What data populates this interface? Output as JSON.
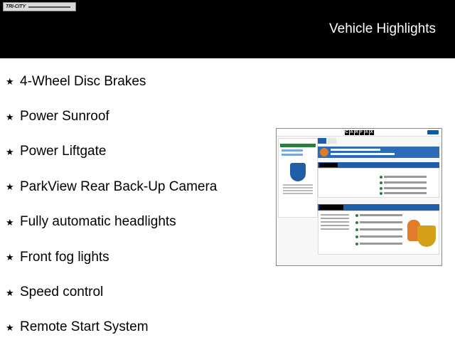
{
  "header": {
    "dealer_logo_text": "TRI-CITY",
    "title": "Vehicle Highlights"
  },
  "features": [
    "4-Wheel Disc Brakes",
    "Power Sunroof",
    "Power Liftgate",
    "ParkView Rear Back-Up Camera",
    "Fully automatic headlights",
    "Front fog lights",
    "Speed control",
    "Remote Start System"
  ],
  "bullet_icon": "star-icon",
  "carfax": {
    "logo_letters": [
      "C",
      "A",
      "R",
      "F",
      "A",
      "X"
    ]
  },
  "colors": {
    "header_bg": "#000000",
    "header_text": "#ffffff",
    "carfax_blue": "#1f5fa8"
  }
}
